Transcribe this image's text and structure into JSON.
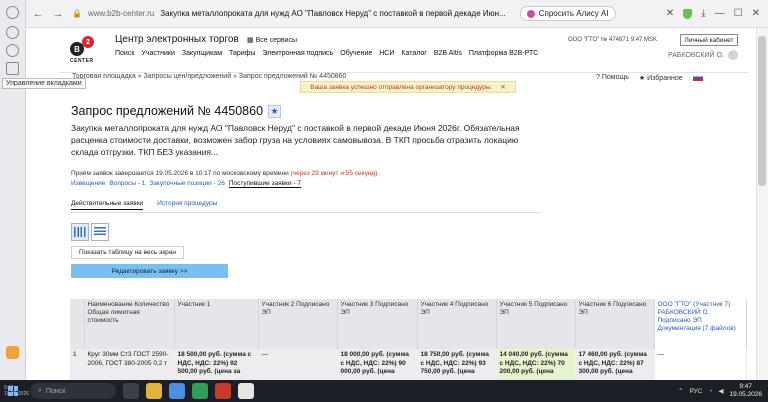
{
  "browser": {
    "domain": "www.b2b-center.ru",
    "tab_title": "Закупка металлопроката для нужд АО \"Павловск Неруд\" с поставкой в первой декаде Июн...",
    "alice_label": "Спросить Алису AI",
    "tooltip": "Управление вкладками"
  },
  "site": {
    "logo_letter": "B",
    "logo_num": "2",
    "logo_sub": "CENTER",
    "name": "Центр электронных торгов",
    "all_services": "Все сервисы",
    "company": "ООО \"ГТО\"  № 474871  9:47 MSK",
    "cabinet": "Личный кабинет",
    "nav": [
      "Поиск",
      "Участники",
      "Закупщикам",
      "Тарифы",
      "Электронная подпись",
      "Обучение",
      "НСИ",
      "Каталог",
      "B2B Altis",
      "Платформа B2B-РТС"
    ],
    "user": "РАБКОВСКИЙ О."
  },
  "breadcrumb": "Торговая площадка » Запросы цен/предложений » Запрос предложений № 4450860",
  "help": {
    "help": "Помощь",
    "fav": "Избранное"
  },
  "notice": {
    "text": "Ваша заявка успешно отправлена организатору процедуры.",
    "close": "✕"
  },
  "page": {
    "title": "Запрос предложений № 4450860",
    "description": "Закупка металлопроката для нужд АО \"Павловск Неруд\" с поставкой в первой декаде Июня 2026г. Обязательная расценка стоимости доставки, возможен забор груза на условиях самовывоза. В ТКП просьба отразить локацию склада отгрузки. ТКП БЕЗ указания...",
    "deadline_label": "Приём заявок завершается 19.05.2026 в 10:17 по московскому времени",
    "deadline_left": "(через 29 минут и 55 секунд) .",
    "subtabs": [
      "Извещение",
      "Вопросы - 1",
      "Закупочные позиции - 26",
      "Поступившие заявки - 7"
    ],
    "tabs": [
      "Действительные заявки",
      "История процедуры"
    ],
    "full_table_btn": "Показать таблицу на весь экран",
    "edit_btn": "Редактировать заявку >>"
  },
  "table": {
    "headers": [
      "",
      "Наименование Количество Общая лимитная стоимость",
      "Участник 1",
      "Участник 2 Подписано ЭП",
      "Участник 3 Подписано ЭП",
      "Участник 4 Подписано ЭП",
      "Участник 5 Подписано ЭП",
      "Участник 6 Подписано ЭП",
      "ООО \"ГТО\" (Участник 7) РАБКОВСКИЙ О. Подписано ЭП Документация (7 файлов)"
    ],
    "row": [
      "1",
      "Круг 30мм Ст3 ГОСТ 2590-2006, ГОСТ 380-2005 0,2 т",
      "18 500,00 руб. (сумма с НДС, НДС: 22%) 92 500,00 руб. (цена за",
      "—",
      "18 000,00 руб. (сумма с НДС, НДС: 22%) 90 000,00 руб. (цена",
      "18 750,00 руб. (сумма с НДС, НДС: 22%) 93 750,00 руб. (цена",
      "14 040,00 руб. (сумма с НДС, НДС: 22%) 70 200,00 руб. (цена",
      "17 460,00 руб. (сумма с НДС, НДС: 22%) 87 300,00 руб. (цена",
      "—"
    ]
  },
  "taskbar": {
    "search": "Поиск",
    "lang": "РУС",
    "time": "9:47",
    "date": "19.05.2026"
  }
}
